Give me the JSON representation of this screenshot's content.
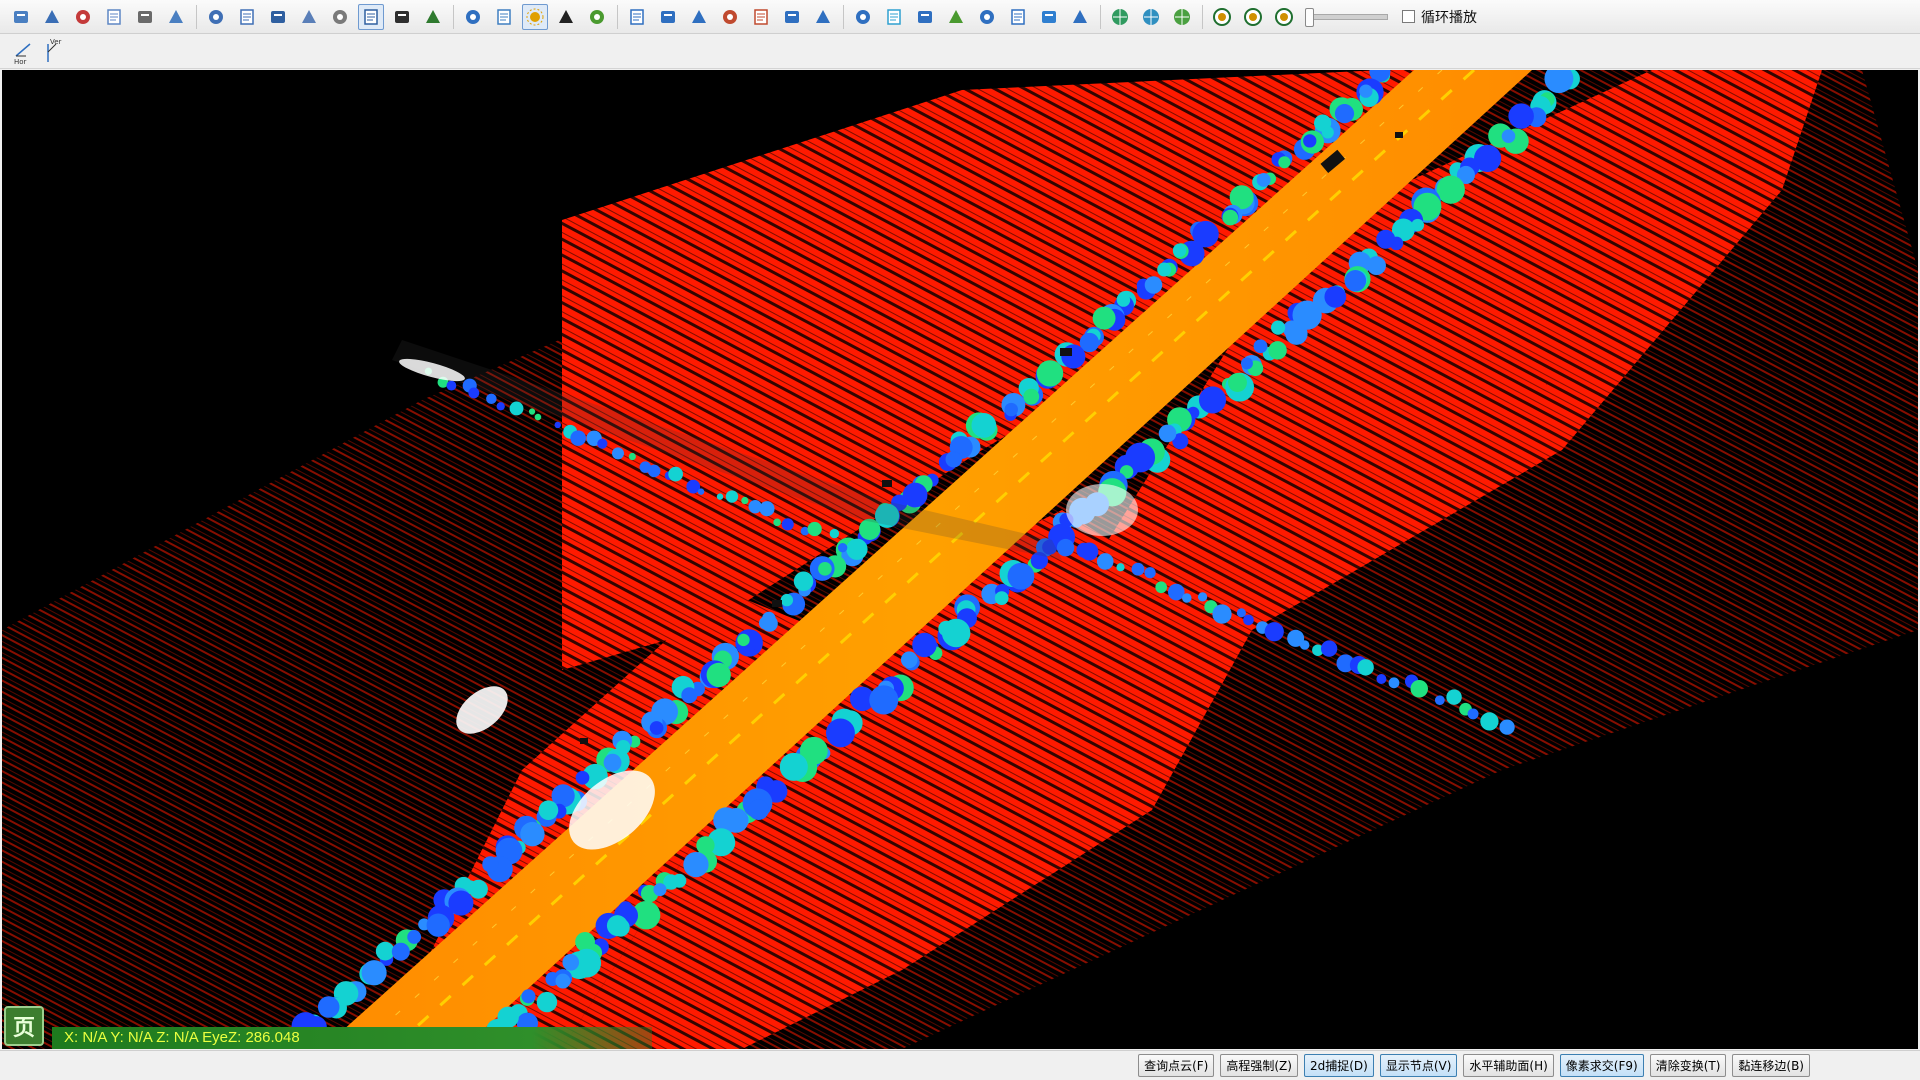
{
  "toolbar": {
    "loop_label": "循环播放",
    "loop_checked": false,
    "buttons": [
      {
        "name": "open-icon",
        "color": "#4a7fc1",
        "active": false
      },
      {
        "name": "save-icon",
        "color": "#3a6eb5",
        "active": false
      },
      {
        "name": "export-icon",
        "color": "#c43a3a",
        "active": false
      },
      {
        "name": "settings-icon",
        "color": "#5d86c4",
        "active": false
      },
      {
        "name": "document-icon",
        "color": "#6a6a6a",
        "active": false
      },
      {
        "name": "edit-icon",
        "color": "#4a7fc1",
        "active": false
      },
      {
        "name": "window-icon",
        "color": "#3f6fb5",
        "active": false
      },
      {
        "name": "camera-icon",
        "color": "#3f6fb5",
        "active": false
      },
      {
        "name": "key-value-icon",
        "color": "#2f5fa0",
        "active": false
      },
      {
        "name": "search-icon",
        "color": "#5a7fb8",
        "active": false
      },
      {
        "name": "v-circle-icon",
        "color": "#7a7a7a",
        "active": false
      },
      {
        "name": "select-box-icon",
        "color": "#2f5fa0",
        "active": true
      },
      {
        "name": "tools-icon",
        "color": "#2f2f2f",
        "active": false
      },
      {
        "name": "tree-icon",
        "color": "#2f7a2f",
        "active": false
      },
      {
        "name": "eye-icon",
        "color": "#2f6fc0",
        "active": false
      },
      {
        "name": "water-icon",
        "color": "#3f7fc1",
        "active": false
      },
      {
        "name": "sun-icon",
        "color": "#e0a000",
        "active": true
      },
      {
        "name": "curve-icon",
        "color": "#222222",
        "active": false
      },
      {
        "name": "branch-icon",
        "color": "#4a9a2f",
        "active": false
      },
      {
        "name": "pointer-icon",
        "color": "#2f6fc0",
        "active": false
      },
      {
        "name": "pencil-icon",
        "color": "#2f6fc0",
        "active": false
      },
      {
        "name": "cursor-select-icon",
        "color": "#2f6fc0",
        "active": false
      },
      {
        "name": "chart-edit-icon",
        "color": "#c04a2f",
        "active": false
      },
      {
        "name": "grid-icon",
        "color": "#c04a2f",
        "active": false
      },
      {
        "name": "layers-icon",
        "color": "#2f6fc0",
        "active": false
      },
      {
        "name": "ruler-icon",
        "color": "#2f6fc0",
        "active": false
      },
      {
        "name": "diamond-icon",
        "color": "#2f6fc0",
        "active": false
      },
      {
        "name": "polygon-icon",
        "color": "#2fa0d0",
        "active": false
      },
      {
        "name": "bar-chart-icon",
        "color": "#2f6fc0",
        "active": false
      },
      {
        "name": "terrain-icon",
        "color": "#4a9a2f",
        "active": false
      },
      {
        "name": "measure-icon",
        "color": "#2f6fc0",
        "active": false
      },
      {
        "name": "xyz-axis-icon",
        "color": "#2f6fc0",
        "active": false
      },
      {
        "name": "bucket-icon",
        "color": "#2f7fd0",
        "active": false
      },
      {
        "name": "z-plus-icon",
        "color": "#2f6fc0",
        "active": false
      },
      {
        "name": "globe-icon",
        "color": "#2f9a5f",
        "active": false
      },
      {
        "name": "globe-layers-icon",
        "color": "#2f8fc0",
        "active": false
      },
      {
        "name": "globe-rotate-icon",
        "color": "#4aa040",
        "active": false
      },
      {
        "name": "play-icon",
        "color": "#1f6f2f",
        "active": false
      },
      {
        "name": "pause-icon",
        "color": "#1f6f2f",
        "active": false
      },
      {
        "name": "rewind-icon",
        "color": "#1f6f2f",
        "active": false
      }
    ]
  },
  "toolbar2": {
    "hor_label": "Hor",
    "ver_label": "Ver"
  },
  "coords": {
    "text": "X: N/A Y: N/A Z: N/A EyeZ: 286.048"
  },
  "logo": {
    "text": "页"
  },
  "status_buttons": [
    {
      "label": "查询点云(F)",
      "active": false
    },
    {
      "label": "高程强制(Z)",
      "active": false
    },
    {
      "label": "2d捕捉(D)",
      "active": true
    },
    {
      "label": "显示节点(V)",
      "active": true
    },
    {
      "label": "水平辅助面(H)",
      "active": false
    },
    {
      "label": "像素求交(F9)",
      "active": true
    },
    {
      "label": "清除变换(T)",
      "active": false
    },
    {
      "label": "黏连移边(B)",
      "active": false
    }
  ],
  "colors": {
    "road": "#ff9a00",
    "ground": "#ff1a00",
    "tree_low": "#1a3cff",
    "tree_mid": "#14d2d2",
    "tree_high": "#ffffff",
    "background": "#000000"
  }
}
